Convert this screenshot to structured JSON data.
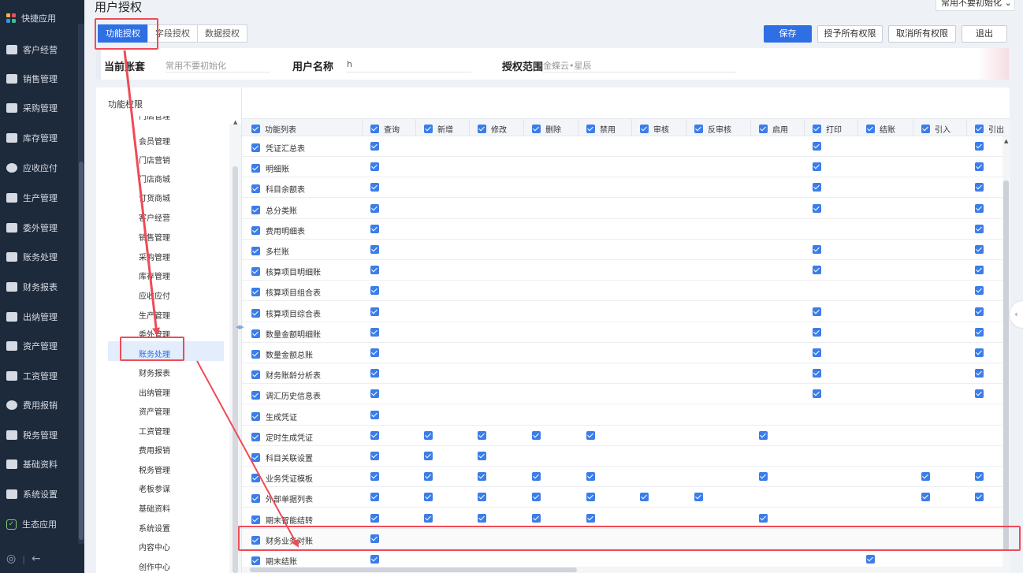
{
  "nav": {
    "items": [
      {
        "label": "快捷应用",
        "icon": "quick-apps-icon"
      },
      {
        "label": "客户经营",
        "icon": "customer-icon"
      },
      {
        "label": "销售管理",
        "icon": "sales-icon"
      },
      {
        "label": "采购管理",
        "icon": "purchase-icon"
      },
      {
        "label": "库存管理",
        "icon": "inventory-icon"
      },
      {
        "label": "应收应付",
        "icon": "receivable-icon"
      },
      {
        "label": "生产管理",
        "icon": "production-icon"
      },
      {
        "label": "委外管理",
        "icon": "outsourcing-icon"
      },
      {
        "label": "账务处理",
        "icon": "accounting-icon"
      },
      {
        "label": "财务报表",
        "icon": "finance-report-icon"
      },
      {
        "label": "出纳管理",
        "icon": "cashier-icon"
      },
      {
        "label": "资产管理",
        "icon": "asset-icon"
      },
      {
        "label": "工资管理",
        "icon": "salary-icon"
      },
      {
        "label": "费用报销",
        "icon": "expense-icon"
      },
      {
        "label": "税务管理",
        "icon": "tax-icon"
      },
      {
        "label": "基础资料",
        "icon": "basic-data-icon"
      },
      {
        "label": "系统设置",
        "icon": "settings-icon"
      },
      {
        "label": "生态应用",
        "icon": "eco-apps-icon"
      }
    ],
    "footer_left": "◎",
    "footer_sep": "|",
    "footer_back": "←"
  },
  "header": {
    "title": "用户授权",
    "account_dropdown": "常用不要初始化",
    "tabs": [
      "功能授权",
      "字段授权",
      "数据授权"
    ],
    "buttons": {
      "save": "保存",
      "grant_all": "授予所有权限",
      "revoke_all": "取消所有权限",
      "exit": "退出"
    }
  },
  "info": {
    "account_label": "当前账套",
    "account_value": "常用不要初始化",
    "user_label": "用户名称",
    "user_value": "h",
    "scope_label": "授权范围",
    "scope_value": "金蝶云•星辰"
  },
  "tree": {
    "header": "功能权限",
    "items": [
      "门店管理",
      "会员管理",
      "门店营销",
      "门店商城",
      "订货商城",
      "客户经营",
      "销售管理",
      "采购管理",
      "库存管理",
      "应收应付",
      "生产管理",
      "委外管理",
      "账务处理",
      "财务报表",
      "出纳管理",
      "资产管理",
      "工资管理",
      "费用报销",
      "税务管理",
      "老板参谋",
      "基础资料",
      "系统设置",
      "内容中心",
      "创作中心"
    ],
    "selected": "账务处理"
  },
  "grid": {
    "columns": [
      "功能列表",
      "查询",
      "新增",
      "修改",
      "删除",
      "禁用",
      "审核",
      "反审核",
      "启用",
      "打印",
      "结账",
      "引入",
      "引出"
    ],
    "rows": [
      {
        "name": "凭证汇总表",
        "checks": [
          "查询",
          "打印",
          "引出"
        ]
      },
      {
        "name": "明细账",
        "checks": [
          "查询",
          "打印",
          "引出"
        ]
      },
      {
        "name": "科目余额表",
        "checks": [
          "查询",
          "打印",
          "引出"
        ]
      },
      {
        "name": "总分类账",
        "checks": [
          "查询",
          "打印",
          "引出"
        ]
      },
      {
        "name": "费用明细表",
        "checks": [
          "查询",
          "引出"
        ]
      },
      {
        "name": "多栏账",
        "checks": [
          "查询",
          "打印",
          "引出"
        ]
      },
      {
        "name": "核算项目明细账",
        "checks": [
          "查询",
          "打印",
          "引出"
        ]
      },
      {
        "name": "核算项目组合表",
        "checks": [
          "查询",
          "引出"
        ]
      },
      {
        "name": "核算项目综合表",
        "checks": [
          "查询",
          "打印",
          "引出"
        ]
      },
      {
        "name": "数量金额明细账",
        "checks": [
          "查询",
          "打印",
          "引出"
        ]
      },
      {
        "name": "数量金额总账",
        "checks": [
          "查询",
          "打印",
          "引出"
        ]
      },
      {
        "name": "财务账龄分析表",
        "checks": [
          "查询",
          "打印",
          "引出"
        ]
      },
      {
        "name": "调汇历史信息表",
        "checks": [
          "查询",
          "打印",
          "引出"
        ]
      },
      {
        "name": "生成凭证",
        "checks": [
          "查询"
        ]
      },
      {
        "name": "定时生成凭证",
        "checks": [
          "查询",
          "新增",
          "修改",
          "删除",
          "禁用",
          "启用"
        ]
      },
      {
        "name": "科目关联设置",
        "checks": [
          "查询",
          "新增",
          "修改"
        ]
      },
      {
        "name": "业务凭证模板",
        "checks": [
          "查询",
          "新增",
          "修改",
          "删除",
          "禁用",
          "启用",
          "引入",
          "引出"
        ]
      },
      {
        "name": "外部单据列表",
        "checks": [
          "查询",
          "新增",
          "修改",
          "删除",
          "禁用",
          "审核",
          "反审核",
          "引入",
          "引出"
        ]
      },
      {
        "name": "期末智能结转",
        "checks": [
          "查询",
          "新增",
          "修改",
          "删除",
          "禁用",
          "启用"
        ]
      },
      {
        "name": "财务业务对账",
        "checks": [
          "查询"
        ]
      },
      {
        "name": "期末结账",
        "checks": [
          "查询",
          "结账"
        ]
      }
    ],
    "highlighted_row": "财务业务对账"
  },
  "colors": {
    "accent": "#2f6fe4",
    "nav_bg": "#1d2a3c",
    "annotation": "#ef4b57"
  }
}
